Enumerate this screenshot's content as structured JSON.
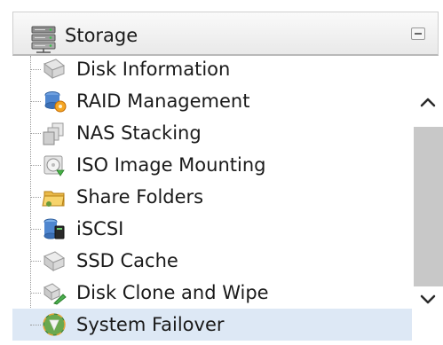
{
  "panel": {
    "title": "Storage",
    "header_icon": "storage-server-icon",
    "collapse_icon": "collapse-minus-icon"
  },
  "tree": {
    "items": [
      {
        "label": "Disk Information",
        "icon": "disk-information-icon"
      },
      {
        "label": "RAID Management",
        "icon": "raid-management-icon"
      },
      {
        "label": "NAS Stacking",
        "icon": "nas-stacking-icon"
      },
      {
        "label": "ISO Image Mounting",
        "icon": "iso-image-mounting-icon"
      },
      {
        "label": "Share Folders",
        "icon": "share-folders-icon"
      },
      {
        "label": "iSCSI",
        "icon": "iscsi-icon"
      },
      {
        "label": "SSD Cache",
        "icon": "ssd-cache-icon"
      },
      {
        "label": "Disk Clone and Wipe",
        "icon": "disk-clone-wipe-icon"
      },
      {
        "label": "System Failover",
        "icon": "system-failover-icon",
        "selected": true
      }
    ]
  },
  "scrollbar": {
    "up_icon": "chevron-up-icon",
    "down_icon": "chevron-down-icon"
  },
  "colors": {
    "selected_bg": "#dde8f5",
    "scroll_track": "#c8c8c8"
  }
}
